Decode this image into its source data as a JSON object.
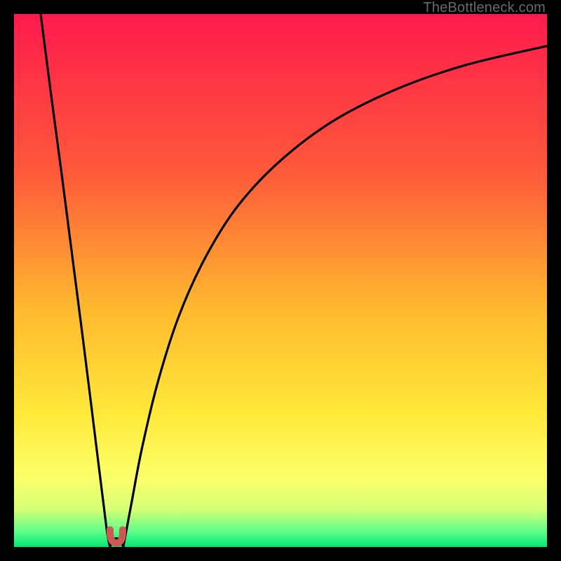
{
  "watermark": "TheBottleneck.com",
  "chart_data": {
    "type": "line",
    "title": "",
    "xlabel": "",
    "ylabel": "",
    "xlim": [
      0,
      100
    ],
    "ylim": [
      0,
      100
    ],
    "grid": false,
    "legend": false,
    "gradient_stops": [
      {
        "offset": 0.0,
        "color": "#ff1a4d"
      },
      {
        "offset": 0.3,
        "color": "#ff5a3a"
      },
      {
        "offset": 0.55,
        "color": "#ffb82e"
      },
      {
        "offset": 0.75,
        "color": "#ffe93a"
      },
      {
        "offset": 0.87,
        "color": "#fcff6a"
      },
      {
        "offset": 0.93,
        "color": "#d4ff75"
      },
      {
        "offset": 0.97,
        "color": "#62ff8a"
      },
      {
        "offset": 1.0,
        "color": "#00e676"
      }
    ],
    "series": [
      {
        "name": "left-branch",
        "x": [
          5.0,
          7.0,
          9.0,
          11.0,
          13.0,
          14.5,
          15.8,
          16.8,
          17.5,
          18.0
        ],
        "y": [
          100.0,
          84.5,
          69.5,
          54.0,
          38.5,
          26.5,
          16.0,
          8.0,
          2.5,
          0.0
        ]
      },
      {
        "name": "dip",
        "x": [
          18.0,
          18.6,
          19.2,
          19.9,
          20.5
        ],
        "y": [
          0.0,
          1.3,
          1.6,
          1.3,
          0.0
        ]
      },
      {
        "name": "right-branch",
        "x": [
          20.5,
          22.0,
          24.0,
          27.0,
          31.0,
          36.0,
          42.0,
          50.0,
          60.0,
          72.0,
          85.0,
          100.0
        ],
        "y": [
          0.0,
          8.0,
          18.5,
          31.0,
          43.5,
          54.5,
          64.0,
          72.5,
          80.0,
          86.0,
          90.5,
          94.0
        ]
      }
    ],
    "marker": {
      "name": "trough-marker",
      "shape": "u",
      "x_center": 19.2,
      "y_center": 1.8,
      "color": "#cc5a52"
    }
  }
}
